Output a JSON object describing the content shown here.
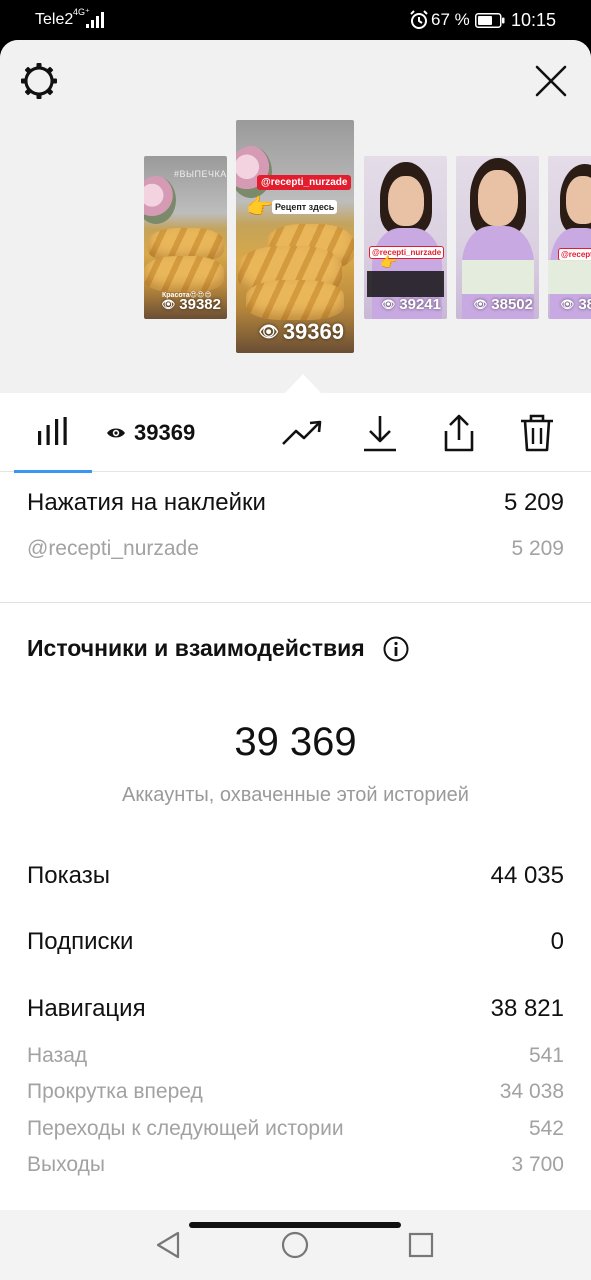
{
  "status_bar": {
    "carrier": "Tele2",
    "network": "4G⁺",
    "battery_percent": "67 %",
    "time": "10:15"
  },
  "header": {
    "settings_icon": "gear-icon",
    "close_icon": "close-icon"
  },
  "stories": [
    {
      "views": "39382",
      "overlay": "#ВЫПЕЧКА",
      "caption": "Красота😍😍😍",
      "selected": false
    },
    {
      "views": "39369",
      "sticker": "@recepti_nurzade",
      "sticker_secondary": "Рецепт здесь",
      "selected": true
    },
    {
      "views": "39241",
      "sticker": "@recepti_nurzade",
      "selected": false
    },
    {
      "views": "38502",
      "selected": false
    },
    {
      "views": "38",
      "sticker": "@recepti",
      "selected": false
    }
  ],
  "tabs": {
    "stats_icon": "bar-chart-icon",
    "views_value": "39369",
    "views_icon": "eye-icon",
    "trend_icon": "trend-up-icon",
    "download_icon": "download-icon",
    "share_icon": "share-icon",
    "delete_icon": "trash-icon",
    "accent": "#3897f0"
  },
  "sticker_taps": {
    "label": "Нажатия на наклейки",
    "value": "5 209",
    "items": [
      {
        "label": "@recepti_nurzade",
        "value": "5 209"
      }
    ]
  },
  "interactions": {
    "title": "Источники и взаимодействия",
    "info_icon": "info-icon",
    "reach_value": "39 369",
    "reach_label": "Аккаунты, охваченные этой историей",
    "impressions_label": "Показы",
    "impressions_value": "44 035",
    "follows_label": "Подписки",
    "follows_value": "0",
    "navigation_label": "Навигация",
    "navigation_value": "38 821",
    "navigation_items": [
      {
        "label": "Назад",
        "value": "541"
      },
      {
        "label": "Прокрутка вперед",
        "value": "34 038"
      },
      {
        "label": "Переходы к следующей истории",
        "value": "542"
      },
      {
        "label": "Выходы",
        "value": "3 700"
      }
    ]
  },
  "nav_bar": {
    "back_icon": "back-triangle-icon",
    "home_icon": "home-circle-icon",
    "recents_icon": "recents-square-icon"
  }
}
